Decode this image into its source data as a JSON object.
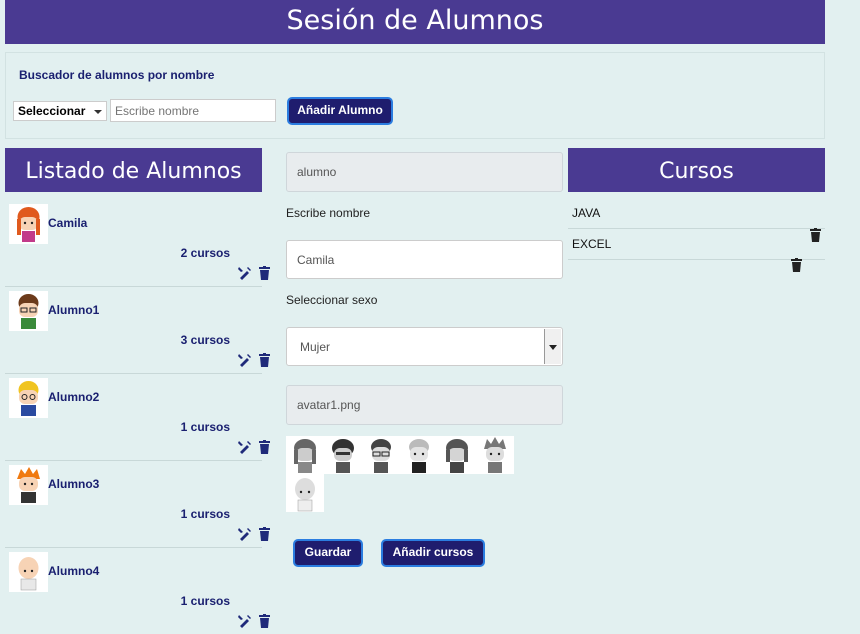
{
  "header": {
    "title": "Sesión de Alumnos"
  },
  "search": {
    "title": "Buscador de alumnos por nombre",
    "select_value": "Seleccionar",
    "name_placeholder": "Escribe nombre",
    "add_student_label": "Añadir Alumno"
  },
  "list": {
    "title": "Listado de Alumnos",
    "students": [
      {
        "name": "Camila",
        "courses": "2 cursos",
        "hair": "#e05a1e"
      },
      {
        "name": "Alumno1",
        "courses": "3 cursos",
        "hair": "#6b3a1a"
      },
      {
        "name": "Alumno2",
        "courses": "1 cursos",
        "hair": "#f0c420"
      },
      {
        "name": "Alumno3",
        "courses": "1 cursos",
        "hair": "#f07a10"
      },
      {
        "name": "Alumno4",
        "courses": "1 cursos",
        "hair": "#f5d8c0"
      }
    ]
  },
  "form": {
    "type_value": "alumno",
    "name_label": "Escribe nombre",
    "name_value": "Camila",
    "sex_label": "Seleccionar sexo",
    "sex_value": "Mujer",
    "avatar_value": "avatar1.png",
    "save_label": "Guardar",
    "add_courses_label": "Añadir cursos"
  },
  "courses": {
    "title": "Cursos",
    "items": [
      {
        "name": "JAVA"
      },
      {
        "name": "EXCEL"
      }
    ]
  },
  "colors": {
    "header_bg": "#4a3a92",
    "button_bg": "#1f1d6e",
    "button_border": "#2b7de0",
    "page_bg": "#e2f0f0"
  }
}
